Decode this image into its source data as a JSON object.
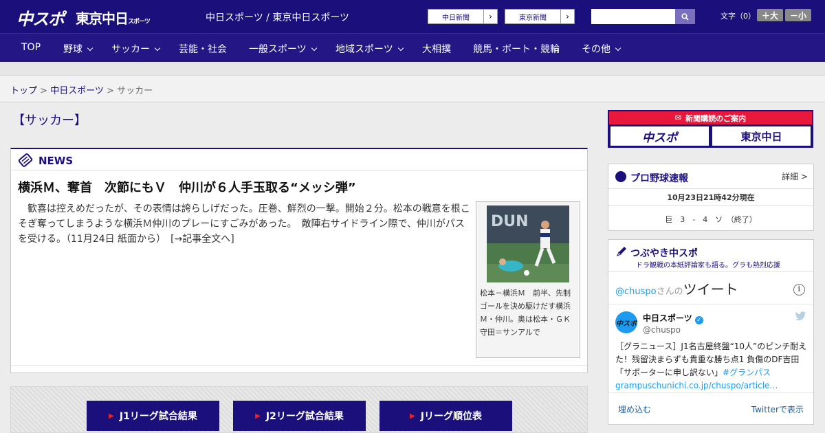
{
  "header": {
    "logo_chuspo": "中スポ",
    "logo_tokyo": "東京中日",
    "logo_tokyo_suffix": "スポーツ",
    "site_names": "中日スポーツ / 東京中日スポーツ",
    "btn_chunichi": "中日新聞",
    "btn_tokyo": "東京新聞",
    "search_placeholder": "",
    "fontsize_label": "文字（0）",
    "fs_plus": "＋大",
    "fs_minus": "－小"
  },
  "nav": {
    "items": [
      "TOP",
      "野球",
      "サッカー",
      "芸能・社会",
      "一般スポーツ",
      "地域スポーツ",
      "大相撲",
      "競馬・ボート・競輪",
      "その他"
    ]
  },
  "breadcrumb": {
    "top": "トップ",
    "sep": " > ",
    "chunichi": "中日スポーツ",
    "current": "サッカー"
  },
  "page_title": "【サッカー】",
  "news": {
    "label": "NEWS",
    "headline": "横浜Ｍ、奪首　次節にもＶ　仲川が６人手玉取る“メッシ弾”",
    "lead": "　歓喜は控えめだったが、その表情は誇らしげだった。圧巻、鮮烈の一撃。開始２分。松本の戦意を根こそぎ奪ってしまうような横浜Ｍ仲川のプレーにすごみがあった。　敵陣右サイドライン際で、仲川がパスを受ける。（11月24日 紙面から）",
    "more": "[→記事全文へ]",
    "caption": "松本－横浜Ｍ　前半、先制ゴールを決め駆けだす横浜Ｍ・仲川。奥は松本・ＧＫ守田＝サンアルで"
  },
  "jleague": {
    "j1": "J1リーグ試合結果",
    "j2": "J2リーグ試合結果",
    "rank": "Jリーグ順位表"
  },
  "sidebar": {
    "subscribe": "新聞購読のご案内",
    "sub_logo1": "中スポ",
    "sub_logo2": "東京中日",
    "baseball": {
      "title": "プロ野球速報",
      "detail": "詳細 >",
      "time": "10月23日21時42分現在",
      "score": "巨　3　-　4　ソ　（終了）"
    },
    "tweet": {
      "title": "つぶやき中スポ",
      "sub": "ドラ観戦の本紙評論家も語る。グラも熱烈応援",
      "embed_user": "@chuspo",
      "embed_san": "さんの",
      "embed_tweet": "ツイート",
      "avatar": "中スポ",
      "name": "中日スポーツ",
      "handle": "@chuspo",
      "text": "［グラニュース］J1名古屋終盤“10人”のピンチ耐えた！残留決まらずも貴重な勝ち点1 負傷のDF吉田「サポーターに申し訳ない」",
      "hashtag": "#グランパス",
      "link": "grampuschunichi.co.jp/chuspo/article…",
      "embed": "埋め込む",
      "view": "Twitterで表示"
    }
  },
  "colors": {
    "navy": "#1b0f7c",
    "red": "#e8173c",
    "twitter": "#1d9bf0"
  }
}
